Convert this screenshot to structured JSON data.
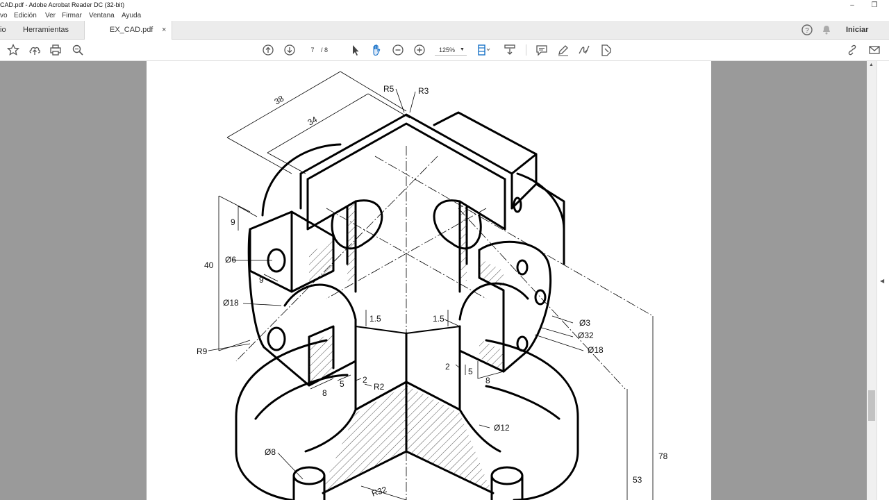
{
  "window": {
    "title": "CAD.pdf - Adobe Acrobat Reader DC (32-bit)",
    "controls": [
      "–",
      "❐"
    ]
  },
  "menu": [
    "vo",
    "Edición",
    "Ver",
    "Firmar",
    "Ventana",
    "Ayuda"
  ],
  "tabs": {
    "home": "io",
    "tools": "Herramientas",
    "document": "EX_CAD.pdf",
    "close": "×"
  },
  "header_right": {
    "help_icon": "help-circle-icon",
    "bell_icon": "bell-icon",
    "signin": "Iniciar sesió"
  },
  "toolbar": {
    "page_current": "7",
    "page_total": "/ 8",
    "zoom": "125%",
    "icons": [
      "star-icon",
      "cloud-upload-icon",
      "print-icon",
      "zoom-search-icon",
      "page-up-icon",
      "page-down-icon",
      "select-cursor-icon",
      "hand-icon",
      "zoom-out-icon",
      "zoom-in-icon",
      "fit-page-icon",
      "scroll-mode-icon",
      "comment-icon",
      "pen-icon",
      "sign-icon",
      "stamp-icon",
      "share-link-icon",
      "email-icon"
    ]
  },
  "colors": {
    "viewer_bg": "#9a9a9a",
    "tabbar_bg": "#ececec",
    "page_bg": "#ffffff",
    "accent_blue": "#1a73c8"
  },
  "drawing": {
    "dimensions": {
      "d38": "38",
      "d34": "34",
      "r5": "R5",
      "r3": "R3",
      "d9a": "9",
      "d40": "40",
      "phi6": "Ø6",
      "d9b": "9",
      "phi18a": "Ø18",
      "r9": "R9",
      "d1_5a": "1.5",
      "d1_5b": "1.5",
      "phi3": "Ø3",
      "phi32": "Ø32",
      "phi18b": "Ø18",
      "d2a": "2",
      "d5a": "5",
      "d8a": "8",
      "d8b": "8",
      "d5b": "5",
      "d2b": "2",
      "r2": "R2",
      "phi12": "Ø12",
      "phi8": "Ø8",
      "r32": "R32",
      "d78": "78",
      "d53": "53"
    }
  }
}
